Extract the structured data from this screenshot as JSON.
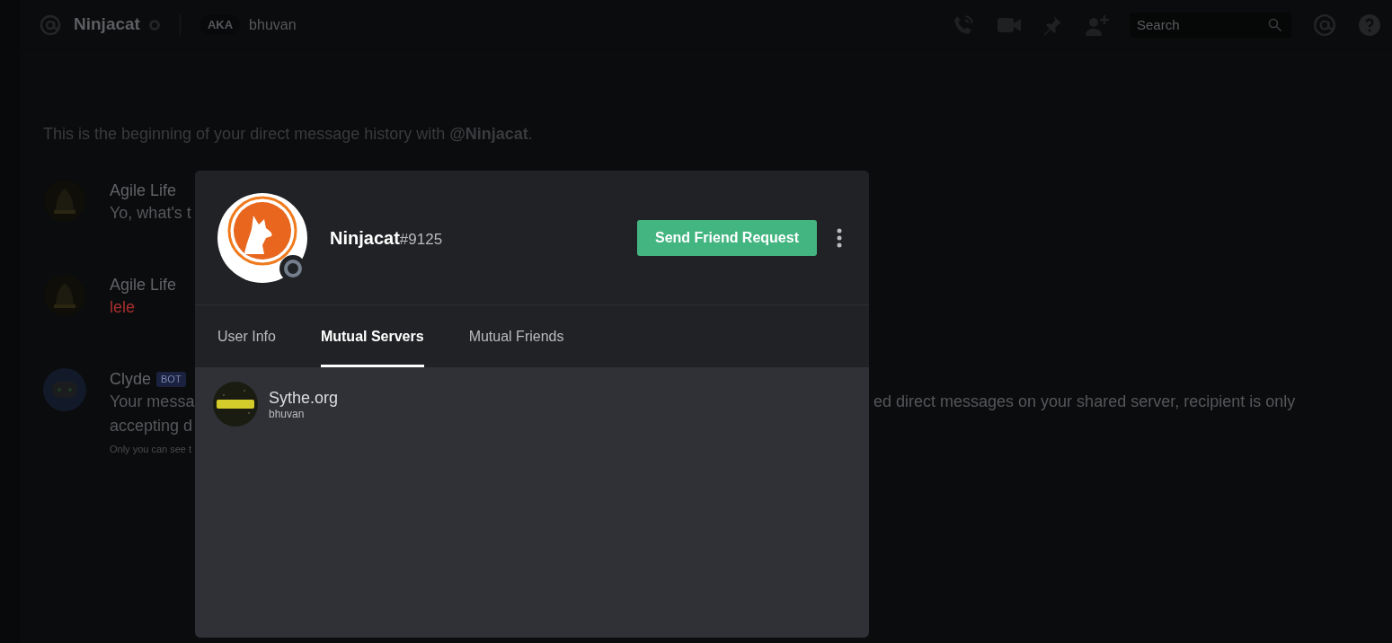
{
  "header": {
    "name": "Ninjacat",
    "aka_label": "AKA",
    "aka_value": "bhuvan",
    "search_placeholder": "Search"
  },
  "intro": "This is the beginning of your direct message history with **@Ninjacat**.",
  "messages": [
    {
      "author": "Agile Life",
      "lines": [
        {
          "left": "Yo, what's t"
        }
      ]
    },
    {
      "author": "Agile Life",
      "lines": [
        {
          "left": "lele",
          "color": "#a83030"
        }
      ]
    },
    {
      "author": "Clyde",
      "badge": "BOT",
      "lines": [
        {
          "left": "Your messa",
          "right": "ed direct messages on your shared server, recipient is only"
        },
        {
          "left": "accepting d"
        }
      ],
      "note": "Only you can see t"
    }
  ],
  "profile": {
    "name": "Ninjacat",
    "discriminator": "#9125",
    "button": "Send Friend Request",
    "tabs": [
      {
        "label": "User Info",
        "selected": false
      },
      {
        "label": "Mutual Servers",
        "selected": true
      },
      {
        "label": "Mutual Friends",
        "selected": false
      }
    ],
    "servers": [
      {
        "name": "Sythe.org",
        "nickname": "bhuvan"
      }
    ]
  }
}
